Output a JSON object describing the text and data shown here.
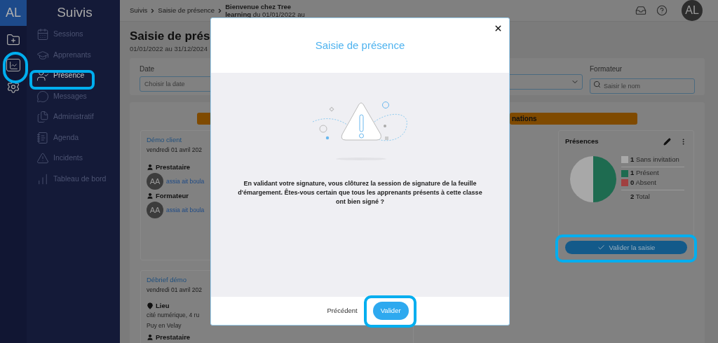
{
  "rail": {
    "logo": "AL"
  },
  "sidebar": {
    "title": "Suivis",
    "items": [
      {
        "label": "Sessions",
        "selected": false
      },
      {
        "label": "Apprenants",
        "selected": false
      },
      {
        "label": "Présence",
        "selected": true
      },
      {
        "label": "Messages",
        "selected": false
      },
      {
        "label": "Administratif",
        "selected": false
      },
      {
        "label": "Agenda",
        "selected": false
      },
      {
        "label": "Incidents",
        "selected": false
      },
      {
        "label": "Tableau de bord",
        "selected": false
      }
    ]
  },
  "header": {
    "breadcrumb": [
      "Suivis",
      "Saisie de présence",
      "**Bienvenue chez Tree learning** du 01/01/2022 au"
    ],
    "avatar": "AL"
  },
  "page": {
    "title": "Saisie de prés",
    "subtitle": "01/01/2022 au 31/12/2024"
  },
  "filters": {
    "date": {
      "label": "Date",
      "placeholder": "Choisir la date"
    },
    "trainer": {
      "label": "Formateur",
      "placeholder": "Saisir le nom"
    }
  },
  "banner_right": "nations",
  "sessions": [
    {
      "title": "Démo client",
      "date": "vendredi 01 avril 202",
      "sections": [
        {
          "kind": "person",
          "heading": "Prestataire",
          "initials": "AA",
          "name": "assia ait boula"
        },
        {
          "kind": "person",
          "heading": "Formateur",
          "initials": "AA",
          "name": "assia ait boula"
        }
      ]
    },
    {
      "title": "Débrief démo",
      "date": "vendredi 01 avril 202",
      "sections": [
        {
          "kind": "place",
          "heading": "Lieu",
          "lines": [
            "cité numérique, 4 ru",
            "Puy en Velay"
          ]
        },
        {
          "kind": "person",
          "heading": "Prestataire"
        }
      ]
    }
  ],
  "presences": {
    "title": "Présences",
    "legend": [
      {
        "count": "1",
        "label": "Sans invitation",
        "color": "#a8a8a8"
      },
      {
        "count": "1",
        "label": "Présent",
        "color": "#1e6b50"
      },
      {
        "count": "0",
        "label": "Absent",
        "color": "#a04040"
      }
    ],
    "total": {
      "count": "2",
      "label": "Total"
    },
    "chart_data": {
      "type": "pie",
      "values": [
        50,
        50,
        0
      ]
    },
    "button": "Valider la saisie"
  },
  "modal": {
    "title": "Saisie de présence",
    "message": "En validant votre signature, vous clôturez la session de signature de la feuille d'émargement. Êtes-vous certain que tous les apprenants présents à cette classe ont bien signé ?",
    "back": "Précédent",
    "confirm": "Valider"
  }
}
